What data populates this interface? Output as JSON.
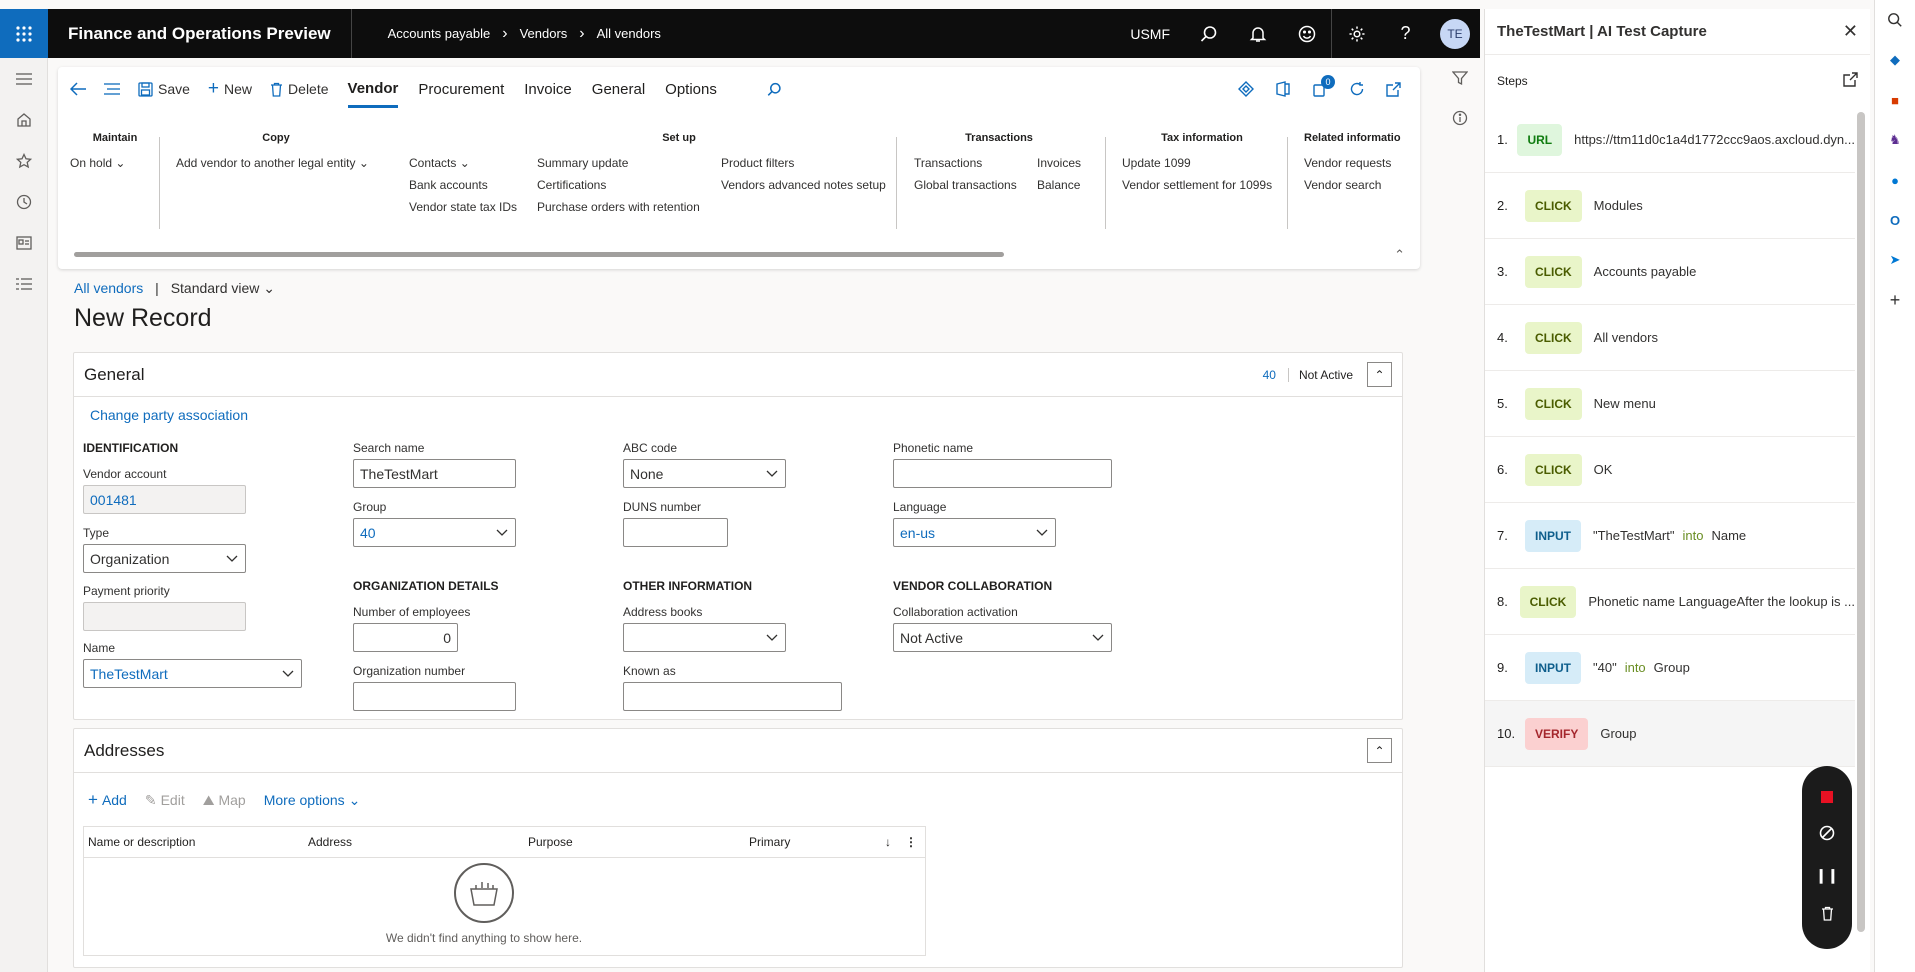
{
  "topbar": {
    "app_title": "Finance and Operations Preview",
    "breadcrumbs": [
      "Accounts payable",
      "Vendors",
      "All vendors"
    ],
    "company": "USMF",
    "avatar_initials": "TE"
  },
  "action_pane": {
    "save": "Save",
    "new": "New",
    "delete": "Delete",
    "tabs": [
      "Vendor",
      "Procurement",
      "Invoice",
      "General",
      "Options"
    ],
    "notification_count": "0",
    "groups": {
      "maintain": {
        "title": "Maintain",
        "items": [
          "On hold"
        ]
      },
      "copy": {
        "title": "Copy",
        "items": [
          "Add vendor to another legal entity"
        ]
      },
      "setup": {
        "title": "Set up",
        "col1": [
          "Contacts",
          "Bank accounts",
          "Vendor state tax IDs"
        ],
        "col2": [
          "Summary update",
          "Certifications",
          "Purchase orders with retention"
        ],
        "col3": [
          "Product filters",
          "Vendors advanced notes setup"
        ]
      },
      "transactions": {
        "title": "Transactions",
        "col1": [
          "Transactions",
          "Global transactions"
        ],
        "col2": [
          "Invoices",
          "Balance"
        ]
      },
      "tax": {
        "title": "Tax information",
        "items": [
          "Update 1099",
          "Vendor settlement for 1099s"
        ]
      },
      "related": {
        "title": "Related informatio",
        "items": [
          "Vendor requests",
          "Vendor search"
        ]
      }
    }
  },
  "page": {
    "breadcrumb_link": "All vendors",
    "separator": "|",
    "view": "Standard view",
    "title": "New Record"
  },
  "general": {
    "title": "General",
    "summary_group": "40",
    "summary_status": "Not Active",
    "change_party": "Change party association",
    "identification": "IDENTIFICATION",
    "vendor_account_label": "Vendor account",
    "vendor_account": "001481",
    "type_label": "Type",
    "type": "Organization",
    "payment_priority_label": "Payment priority",
    "payment_priority": "",
    "name_label": "Name",
    "name": "TheTestMart",
    "search_name_label": "Search name",
    "search_name": "TheTestMart",
    "group_label": "Group",
    "group": "40",
    "org_details": "ORGANIZATION DETAILS",
    "employees_label": "Number of employees",
    "employees": "0",
    "org_number_label": "Organization number",
    "org_number": "",
    "abc_label": "ABC code",
    "abc": "None",
    "duns_label": "DUNS number",
    "duns": "",
    "other_info": "OTHER INFORMATION",
    "address_books_label": "Address books",
    "address_books": "",
    "known_as_label": "Known as",
    "known_as": "",
    "phonetic_label": "Phonetic name",
    "phonetic": "",
    "language_label": "Language",
    "language": "en-us",
    "collab": "VENDOR COLLABORATION",
    "collab_label": "Collaboration activation",
    "collab_value": "Not Active"
  },
  "addresses": {
    "title": "Addresses",
    "add": "Add",
    "edit": "Edit",
    "map": "Map",
    "more": "More options",
    "columns": [
      "Name or description",
      "Address",
      "Purpose",
      "Primary"
    ],
    "empty": "We didn't find anything to show here."
  },
  "panel": {
    "title": "TheTestMart | AI Test Capture",
    "steps_label": "Steps",
    "steps": [
      {
        "n": "1.",
        "type": "URL",
        "text": "https://ttm11d0c1a4d1772ccc9aos.axcloud.dyn..."
      },
      {
        "n": "2.",
        "type": "CLICK",
        "text": "Modules"
      },
      {
        "n": "3.",
        "type": "CLICK",
        "text": "Accounts payable"
      },
      {
        "n": "4.",
        "type": "CLICK",
        "text": "All vendors"
      },
      {
        "n": "5.",
        "type": "CLICK",
        "text": "New menu"
      },
      {
        "n": "6.",
        "type": "CLICK",
        "text": "OK"
      },
      {
        "n": "7.",
        "type": "INPUT",
        "value": "\"TheTestMart\"",
        "into": "into",
        "target": "Name"
      },
      {
        "n": "8.",
        "type": "CLICK",
        "text": "Phonetic name LanguageAfter the lookup is ..."
      },
      {
        "n": "9.",
        "type": "INPUT",
        "value": "\"40\"",
        "into": "into",
        "target": "Group"
      },
      {
        "n": "10.",
        "type": "VERIFY",
        "text": "Group"
      }
    ]
  },
  "colors": {
    "accent": "#0f6cbd",
    "topbar": "#0d0d0d",
    "record": "#e81123"
  }
}
